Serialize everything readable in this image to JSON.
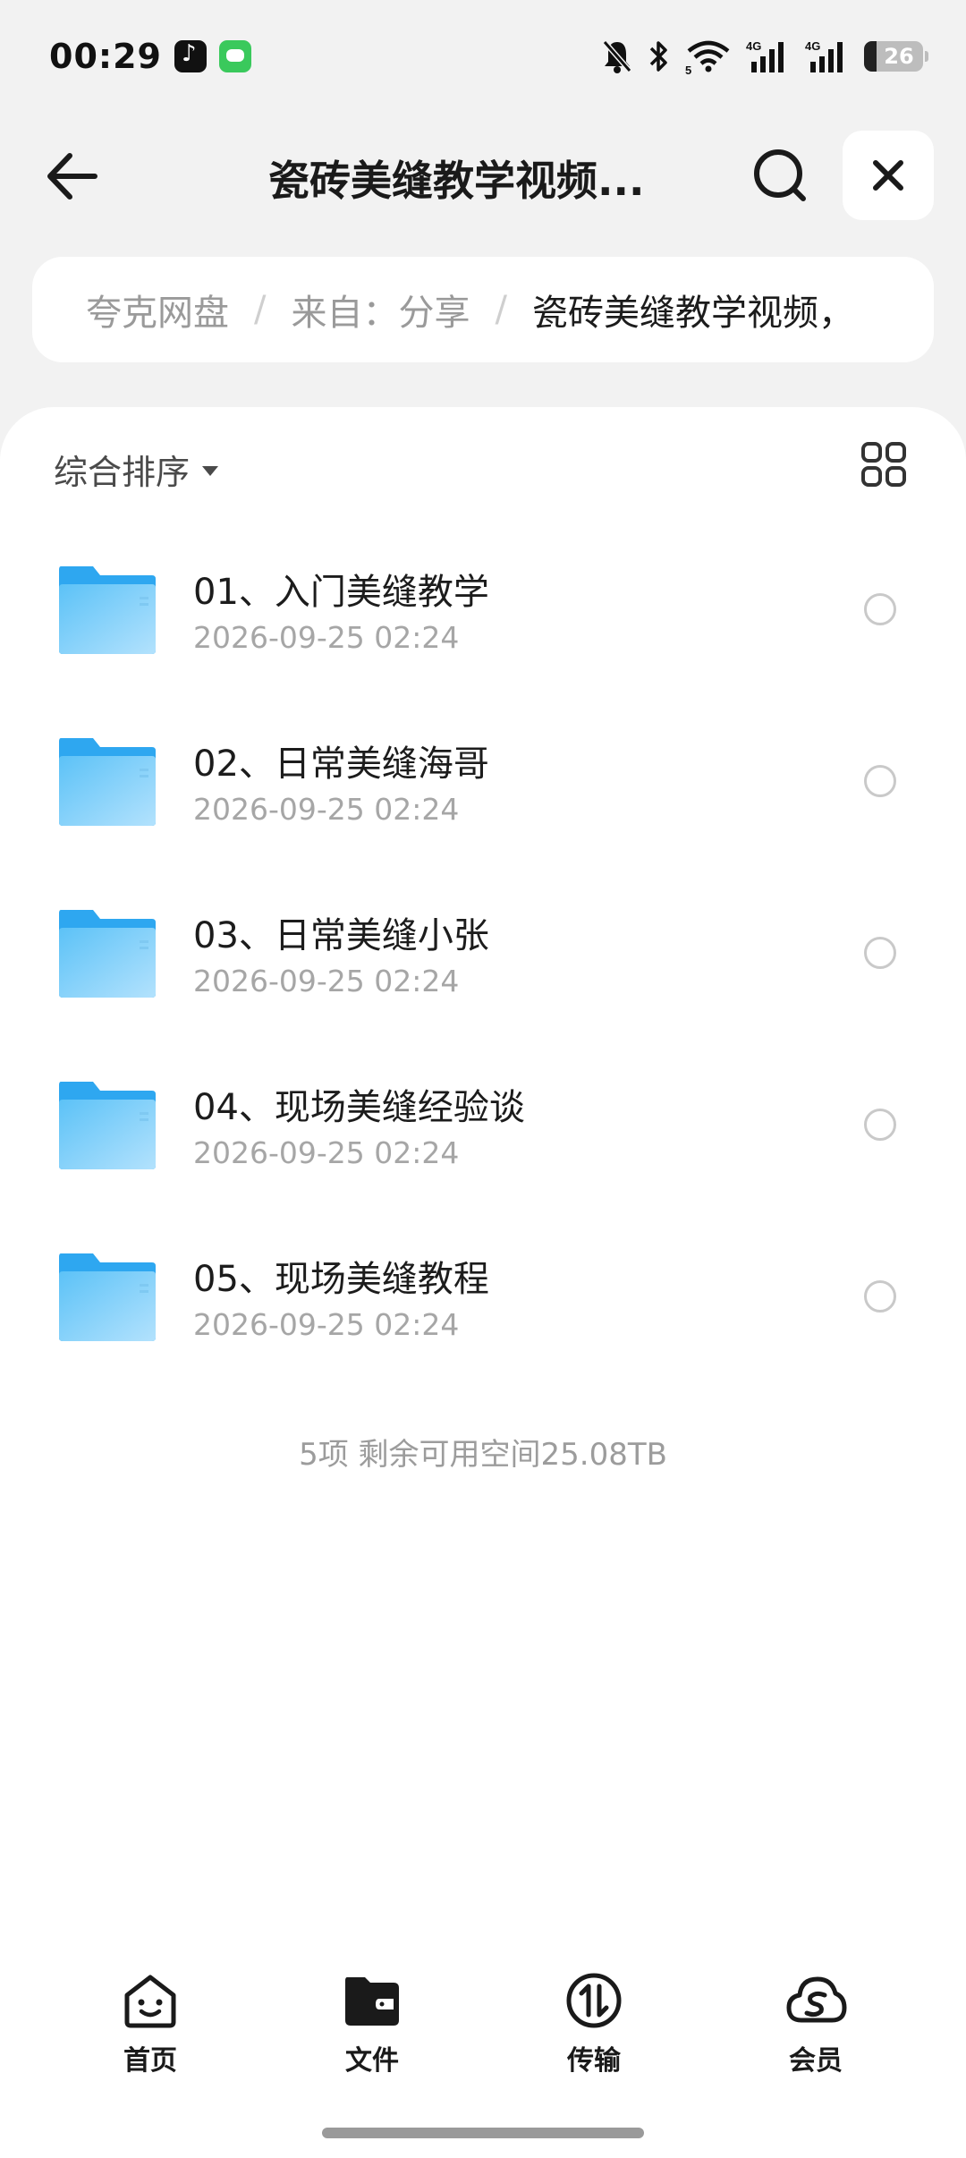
{
  "status_bar": {
    "time": "00:29",
    "battery": "26",
    "icons": [
      "tiktok-app-icon",
      "messages-app-icon",
      "bell-muted-icon",
      "bluetooth-icon",
      "wifi-icon",
      "signal-4g-icon",
      "signal-4g-icon",
      "battery-icon"
    ]
  },
  "header": {
    "title": "瓷砖美缝教学视频...",
    "back_icon": "arrow-left-icon",
    "search_icon": "search-icon",
    "close_icon": "close-icon"
  },
  "breadcrumb": {
    "items": [
      "夸克网盘",
      "来自：分享"
    ],
    "current": "瓷砖美缝教学视频，",
    "separator": "/"
  },
  "toolbar": {
    "sort_label": "综合排序",
    "view_toggle_icon": "grid-view-icon"
  },
  "files": [
    {
      "name": "01、入门美缝教学",
      "date": "2026-09-25 02:24"
    },
    {
      "name": "02、日常美缝海哥",
      "date": "2026-09-25 02:24"
    },
    {
      "name": "03、日常美缝小张",
      "date": "2026-09-25 02:24"
    },
    {
      "name": "04、现场美缝经验谈",
      "date": "2026-09-25 02:24"
    },
    {
      "name": "05、现场美缝教程",
      "date": "2026-09-25 02:24"
    }
  ],
  "summary": "5项 剩余可用空间25.08TB",
  "bottom_nav": [
    {
      "label": "首页",
      "icon": "home-smile-icon"
    },
    {
      "label": "文件",
      "icon": "folder-filled-icon",
      "active": true
    },
    {
      "label": "传输",
      "icon": "transfer-icon"
    },
    {
      "label": "会员",
      "icon": "vip-cloud-icon"
    }
  ],
  "colors": {
    "background": "#f2f2f2",
    "card": "#ffffff",
    "folder_blue": "#4bb8f5",
    "text_primary": "#1c1c1c",
    "text_secondary": "#a6a6a6"
  }
}
